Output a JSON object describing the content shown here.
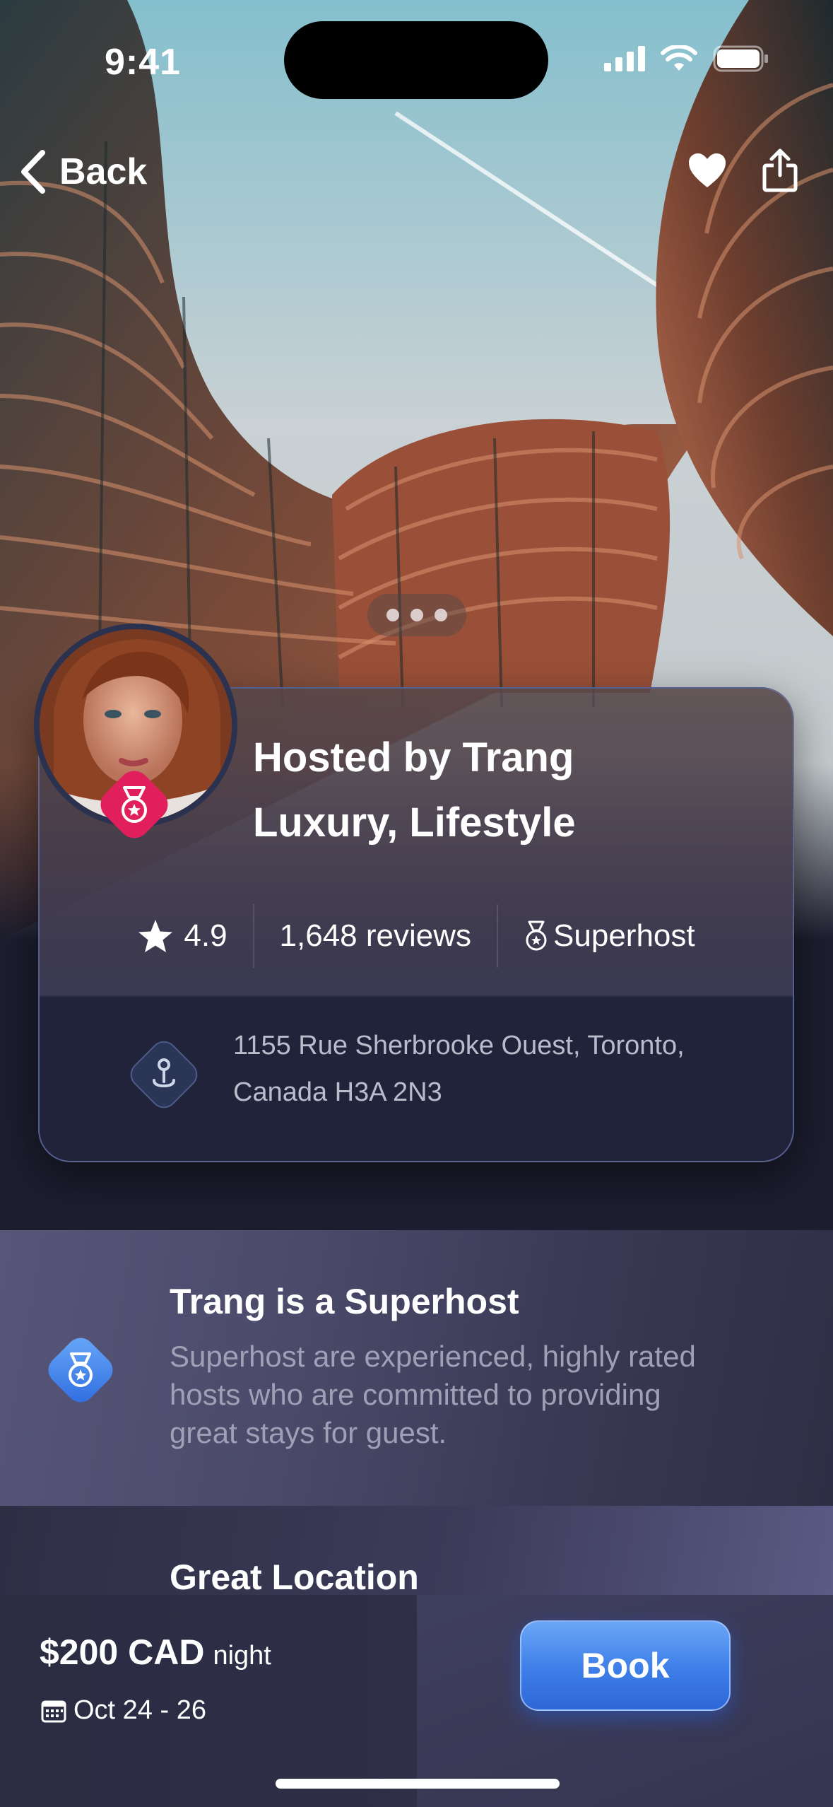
{
  "status_bar": {
    "time": "9:41"
  },
  "nav": {
    "back_label": "Back"
  },
  "host": {
    "title_line1": "Hosted by Trang",
    "title_line2": "Luxury, Lifestyle",
    "rating": "4.9",
    "reviews": "1,648 reviews",
    "badge": "Superhost",
    "address_line1": "1155 Rue Sherbrooke Ouest, Toronto,",
    "address_line2": "Canada H3A 2N3"
  },
  "gallery": {
    "pages": 3
  },
  "superhost_section": {
    "title": "Trang is a Superhost",
    "description": "Superhost are experienced, highly rated hosts who are committed to providing great stays for guest."
  },
  "location_section": {
    "title": "Great Location"
  },
  "booking": {
    "price": "$200 CAD",
    "unit": "night",
    "dates": "Oct 24 - 26",
    "book_label": "Book"
  },
  "colors": {
    "accent_blue": "#3d7ee8",
    "badge_pink": "#e0245e",
    "background": "#1c1d2e"
  },
  "icons": [
    "chevron-left-icon",
    "heart-icon",
    "share-icon",
    "star-icon",
    "medal-icon",
    "location-pin-icon",
    "calendar-icon",
    "signal-icon",
    "wifi-icon",
    "battery-icon"
  ]
}
